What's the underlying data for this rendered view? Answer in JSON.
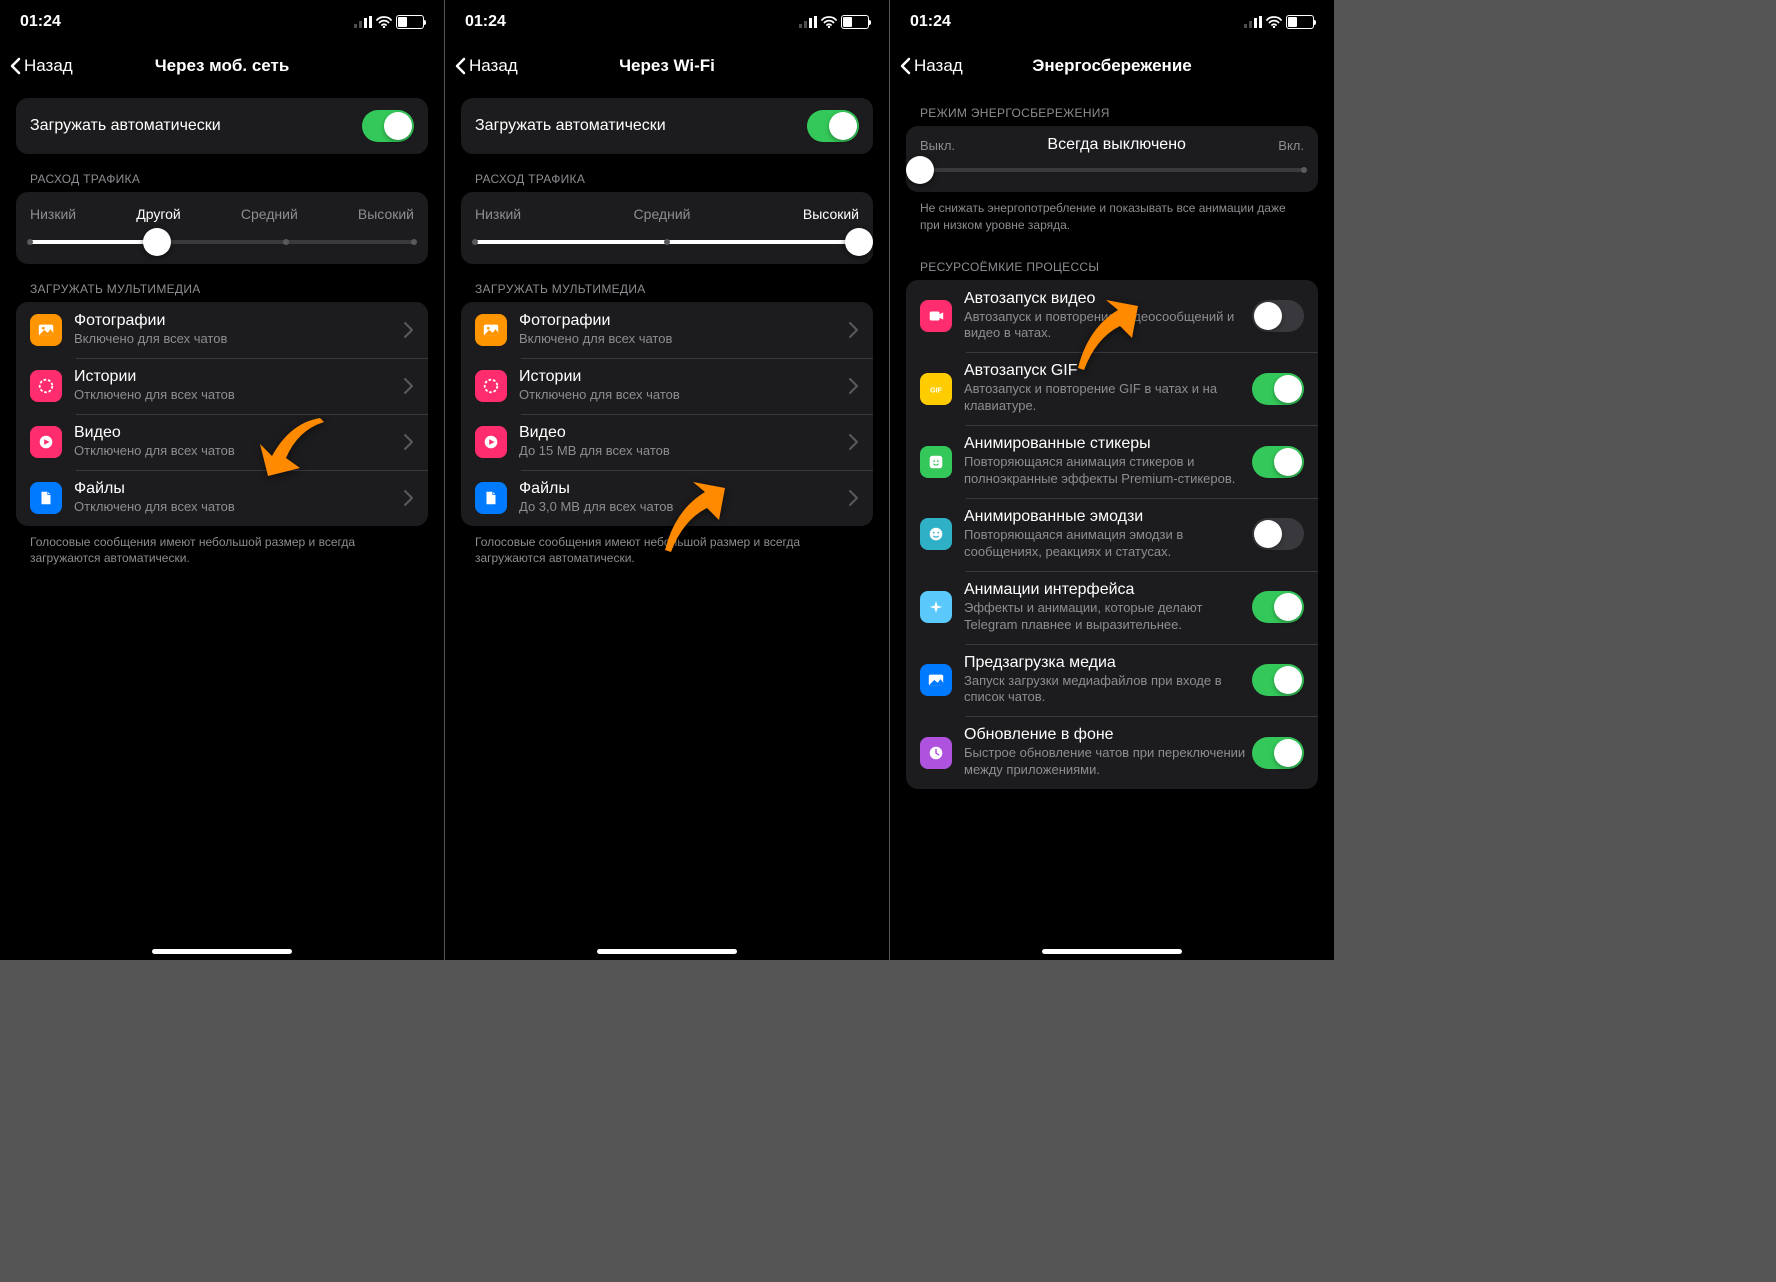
{
  "status": {
    "time": "01:24",
    "battery_pct": "38"
  },
  "s1": {
    "back": "Назад",
    "title": "Через моб. сеть",
    "auto_download": "Загружать автоматически",
    "traffic_header": "РАСХОД ТРАФИКА",
    "traffic_labels": [
      "Низкий",
      "Другой",
      "Средний",
      "Высокий"
    ],
    "media_header": "ЗАГРУЖАТЬ МУЛЬТИМЕДИА",
    "items": [
      {
        "title": "Фотографии",
        "sub": "Включено для всех чатов"
      },
      {
        "title": "Истории",
        "sub": "Отключено для всех чатов"
      },
      {
        "title": "Видео",
        "sub": "Отключено для всех чатов"
      },
      {
        "title": "Файлы",
        "sub": "Отключено для всех чатов"
      }
    ],
    "footer": "Голосовые сообщения имеют небольшой размер и всегда загружаются автоматически."
  },
  "s2": {
    "back": "Назад",
    "title": "Через Wi-Fi",
    "auto_download": "Загружать автоматически",
    "traffic_header": "РАСХОД ТРАФИКА",
    "traffic_labels": [
      "Низкий",
      "Средний",
      "Высокий"
    ],
    "media_header": "ЗАГРУЖАТЬ МУЛЬТИМЕДИА",
    "items": [
      {
        "title": "Фотографии",
        "sub": "Включено для всех чатов"
      },
      {
        "title": "Истории",
        "sub": "Отключено для всех чатов"
      },
      {
        "title": "Видео",
        "sub": "До 15 MB для всех чатов"
      },
      {
        "title": "Файлы",
        "sub": "До 3,0 MB для всех чатов"
      }
    ],
    "footer": "Голосовые сообщения имеют небольшой размер и всегда загружаются автоматически."
  },
  "s3": {
    "back": "Назад",
    "title": "Энергосбережение",
    "mode_header": "РЕЖИМ ЭНЕРГОСБЕРЕЖЕНИЯ",
    "off_label": "Выкл.",
    "on_label": "Вкл.",
    "mode_state": "Всегда выключено",
    "mode_footer": "Не снижать энергопотребление и показывать все анимации даже при низком уровне заряда.",
    "proc_header": "РЕСУРСОЁМКИЕ ПРОЦЕССЫ",
    "items": [
      {
        "title": "Автозапуск видео",
        "sub": "Автозапуск и повторение видеосообщений и видео в чатах.",
        "on": false
      },
      {
        "title": "Автозапуск GIF",
        "sub": "Автозапуск и повторение GIF в чатах и на клавиатуре.",
        "on": true
      },
      {
        "title": "Анимированные стикеры",
        "sub": "Повторяющаяся анимация стикеров и полноэкранные эффекты Premium-стикеров.",
        "on": true
      },
      {
        "title": "Анимированные эмодзи",
        "sub": "Повторяющаяся анимация эмодзи в сообщениях, реакциях и статусах.",
        "on": false
      },
      {
        "title": "Анимации интерфейса",
        "sub": "Эффекты и анимации, которые делают Telegram плавнее и выразительнее.",
        "on": true
      },
      {
        "title": "Предзагрузка медиа",
        "sub": "Запуск загрузки медиафайлов при входе в список чатов.",
        "on": true
      },
      {
        "title": "Обновление в фоне",
        "sub": "Быстрое обновление чатов при переключении между приложениями.",
        "on": true
      }
    ]
  }
}
